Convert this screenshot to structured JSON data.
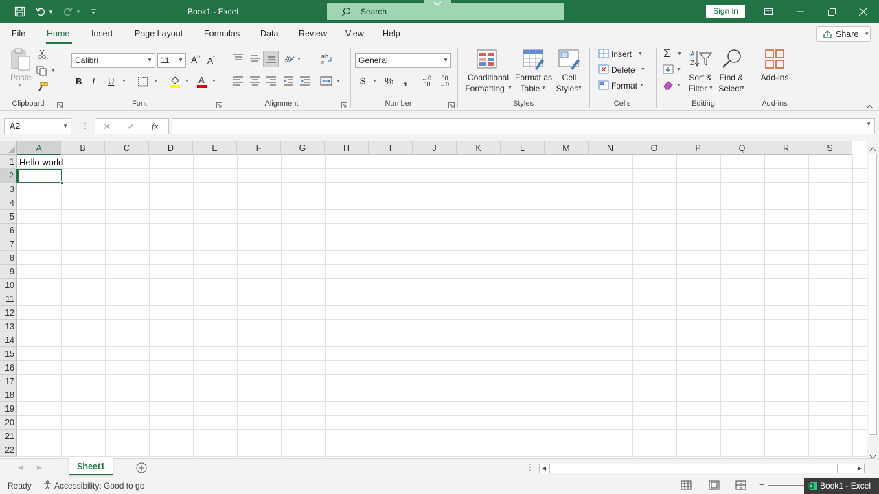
{
  "title_bar": {
    "document_title": "Book1  -  Excel",
    "search_placeholder": "Search",
    "sign_in_label": "Sign in",
    "background_color": "#217346"
  },
  "tabs": [
    {
      "label": "File"
    },
    {
      "label": "Home",
      "active": true
    },
    {
      "label": "Insert"
    },
    {
      "label": "Page Layout"
    },
    {
      "label": "Formulas"
    },
    {
      "label": "Data"
    },
    {
      "label": "Review"
    },
    {
      "label": "View"
    },
    {
      "label": "Help"
    }
  ],
  "share_label": "Share",
  "ribbon": {
    "clipboard": {
      "group": "Clipboard",
      "paste": "Paste"
    },
    "font": {
      "group": "Font",
      "font_name": "Calibri",
      "font_size": "11"
    },
    "alignment": {
      "group": "Alignment"
    },
    "number": {
      "group": "Number",
      "format": "General"
    },
    "styles": {
      "group": "Styles",
      "conditional_line1": "Conditional",
      "conditional_line2": "Formatting",
      "format_table_line1": "Format as",
      "format_table_line2": "Table",
      "cell_styles_line1": "Cell",
      "cell_styles_line2": "Styles"
    },
    "cells": {
      "group": "Cells",
      "insert": "Insert",
      "delete": "Delete",
      "format": "Format"
    },
    "editing": {
      "group": "Editing",
      "sort_line1": "Sort &",
      "sort_line2": "Filter",
      "find_line1": "Find &",
      "find_line2": "Select"
    },
    "addins": {
      "group": "Add-ins",
      "label": "Add-ins"
    }
  },
  "formula_bar": {
    "name_box": "A2",
    "formula": ""
  },
  "grid": {
    "columns": [
      "A",
      "B",
      "C",
      "D",
      "E",
      "F",
      "G",
      "H",
      "I",
      "J",
      "K",
      "L",
      "M",
      "N",
      "O",
      "P",
      "Q",
      "R",
      "S"
    ],
    "rows": [
      "1",
      "2",
      "3",
      "4",
      "5",
      "6",
      "7",
      "8",
      "9",
      "10",
      "11",
      "12",
      "13",
      "14",
      "15",
      "16",
      "17",
      "18",
      "19",
      "20",
      "21",
      "22"
    ],
    "cell_A1": "Hello world",
    "selected_cell": "A2"
  },
  "sheets": [
    {
      "name": "Sheet1",
      "active": true
    }
  ],
  "status": {
    "ready": "Ready",
    "accessibility": "Accessibility: Good to go",
    "taskbar_tooltip": "Book1 - Excel"
  }
}
